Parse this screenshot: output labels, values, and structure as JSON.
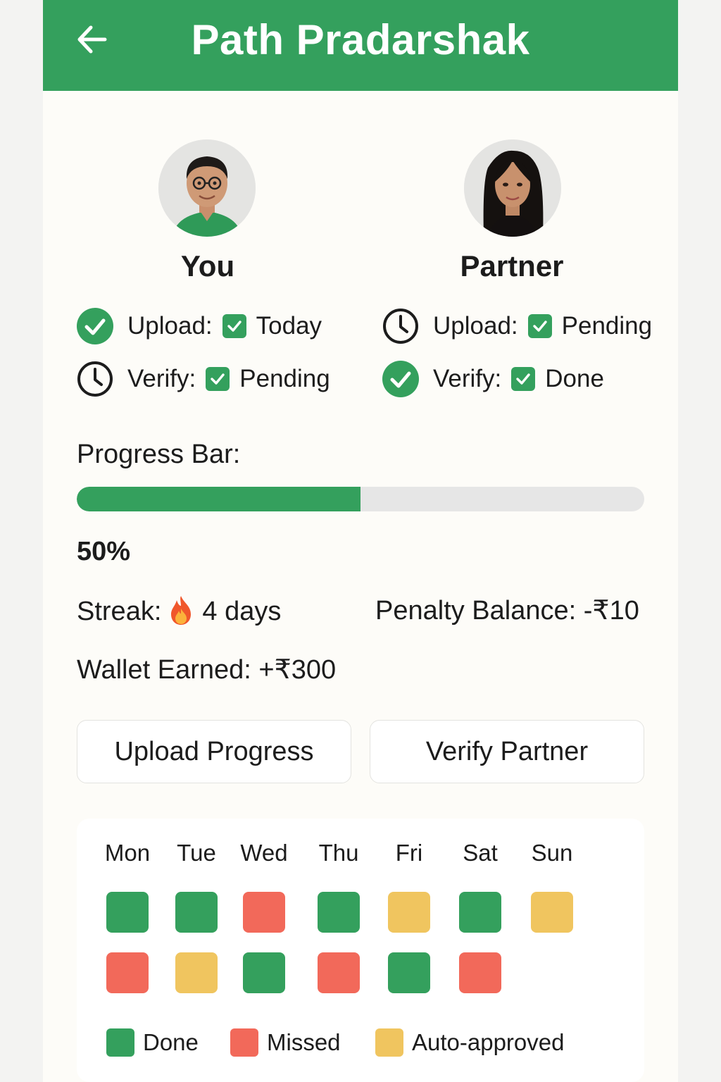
{
  "header": {
    "title": "Path Pradarshak",
    "back_icon": "arrow-left-icon"
  },
  "colors": {
    "brand": "#34a05d",
    "done": "#34a05d",
    "missed": "#f2695a",
    "auto_approved": "#f0c55f"
  },
  "you": {
    "name": "You",
    "upload": {
      "label": "Upload:",
      "value": "Today",
      "icon": "check-circle-icon"
    },
    "verify": {
      "label": "Verify:",
      "value": "Pending",
      "icon": "clock-icon"
    }
  },
  "partner": {
    "name": "Partner",
    "upload": {
      "label": "Upload:",
      "value": "Pending",
      "icon": "clock-icon"
    },
    "verify": {
      "label": "Verify:",
      "value": "Done",
      "icon": "check-circle-icon"
    }
  },
  "progress": {
    "label": "Progress Bar:",
    "fraction": 0.5,
    "percent_text": "50%"
  },
  "stats": {
    "streak_label": "Streak:",
    "streak_value": "4 days",
    "penalty": "Penalty Balance: -₹10",
    "wallet": "Wallet Earned: +₹300"
  },
  "actions": {
    "upload_label": "Upload Progress",
    "verify_label": "Verify Partner"
  },
  "calendar": {
    "days": [
      "Mon",
      "Tue",
      "Wed",
      "Thu",
      "Fri",
      "Sat",
      "Sun"
    ],
    "weeks": [
      [
        "done",
        "done",
        "missed",
        "done",
        "auto",
        "done",
        "auto"
      ],
      [
        "missed",
        "auto",
        "done",
        "missed",
        "done",
        "missed"
      ]
    ],
    "legend": {
      "done": "Done",
      "missed": "Missed",
      "auto": "Auto-approved"
    }
  }
}
